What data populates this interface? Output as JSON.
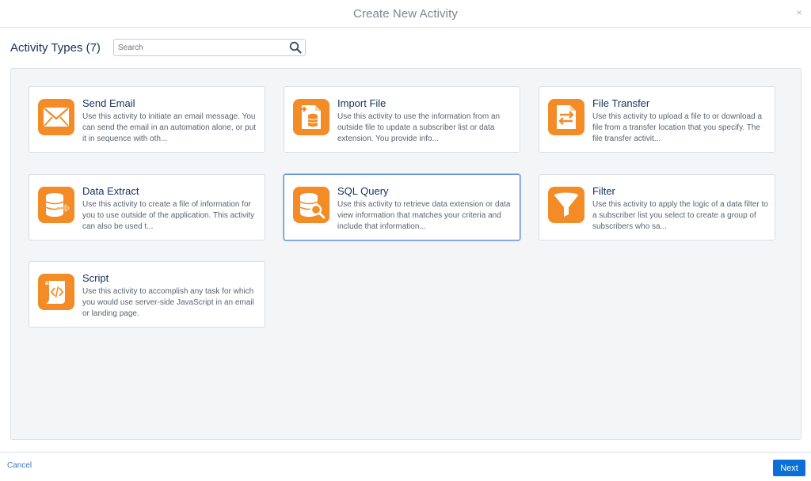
{
  "header": {
    "title": "Create New Activity",
    "close_glyph": "×"
  },
  "activity_types": {
    "title": "Activity Types (7)"
  },
  "search": {
    "placeholder": "Search",
    "value": ""
  },
  "accent_color": "#f38b26",
  "selection_color": "#5c8fd6",
  "cards": [
    {
      "title": "Send Email",
      "icon": "envelope-icon",
      "selected": false,
      "description": "Use this activity to initiate an email message. You can send the email in an automation alone, or put it in sequence with oth..."
    },
    {
      "title": "Import File",
      "icon": "import-file-icon",
      "selected": false,
      "description": "Use this activity to use the information from an outside file to update a subscriber list or data extension. You provide info..."
    },
    {
      "title": "File Transfer",
      "icon": "file-transfer-icon",
      "selected": false,
      "description": "Use this activity to upload a file to or download a file from a transfer location that you specify. The file transfer activit..."
    },
    {
      "title": "Data Extract",
      "icon": "data-extract-icon",
      "selected": false,
      "description": "Use this activity to create a file of information for you to use outside of the application. This activity can also be used t..."
    },
    {
      "title": "SQL Query",
      "icon": "sql-query-icon",
      "selected": true,
      "description": "Use this activity to retrieve data extension or data view information that matches your criteria and include that information..."
    },
    {
      "title": "Filter",
      "icon": "filter-funnel-icon",
      "selected": false,
      "description": "Use this activity to apply the logic of a data filter to a subscriber list you select to create a group of subscribers who sa..."
    },
    {
      "title": "Script",
      "icon": "script-icon",
      "selected": false,
      "description": "Use this activity to accomplish any task for which you would use server-side JavaScript in an email or landing page."
    }
  ],
  "footer": {
    "cancel_label": "Cancel",
    "next_label": "Next"
  }
}
